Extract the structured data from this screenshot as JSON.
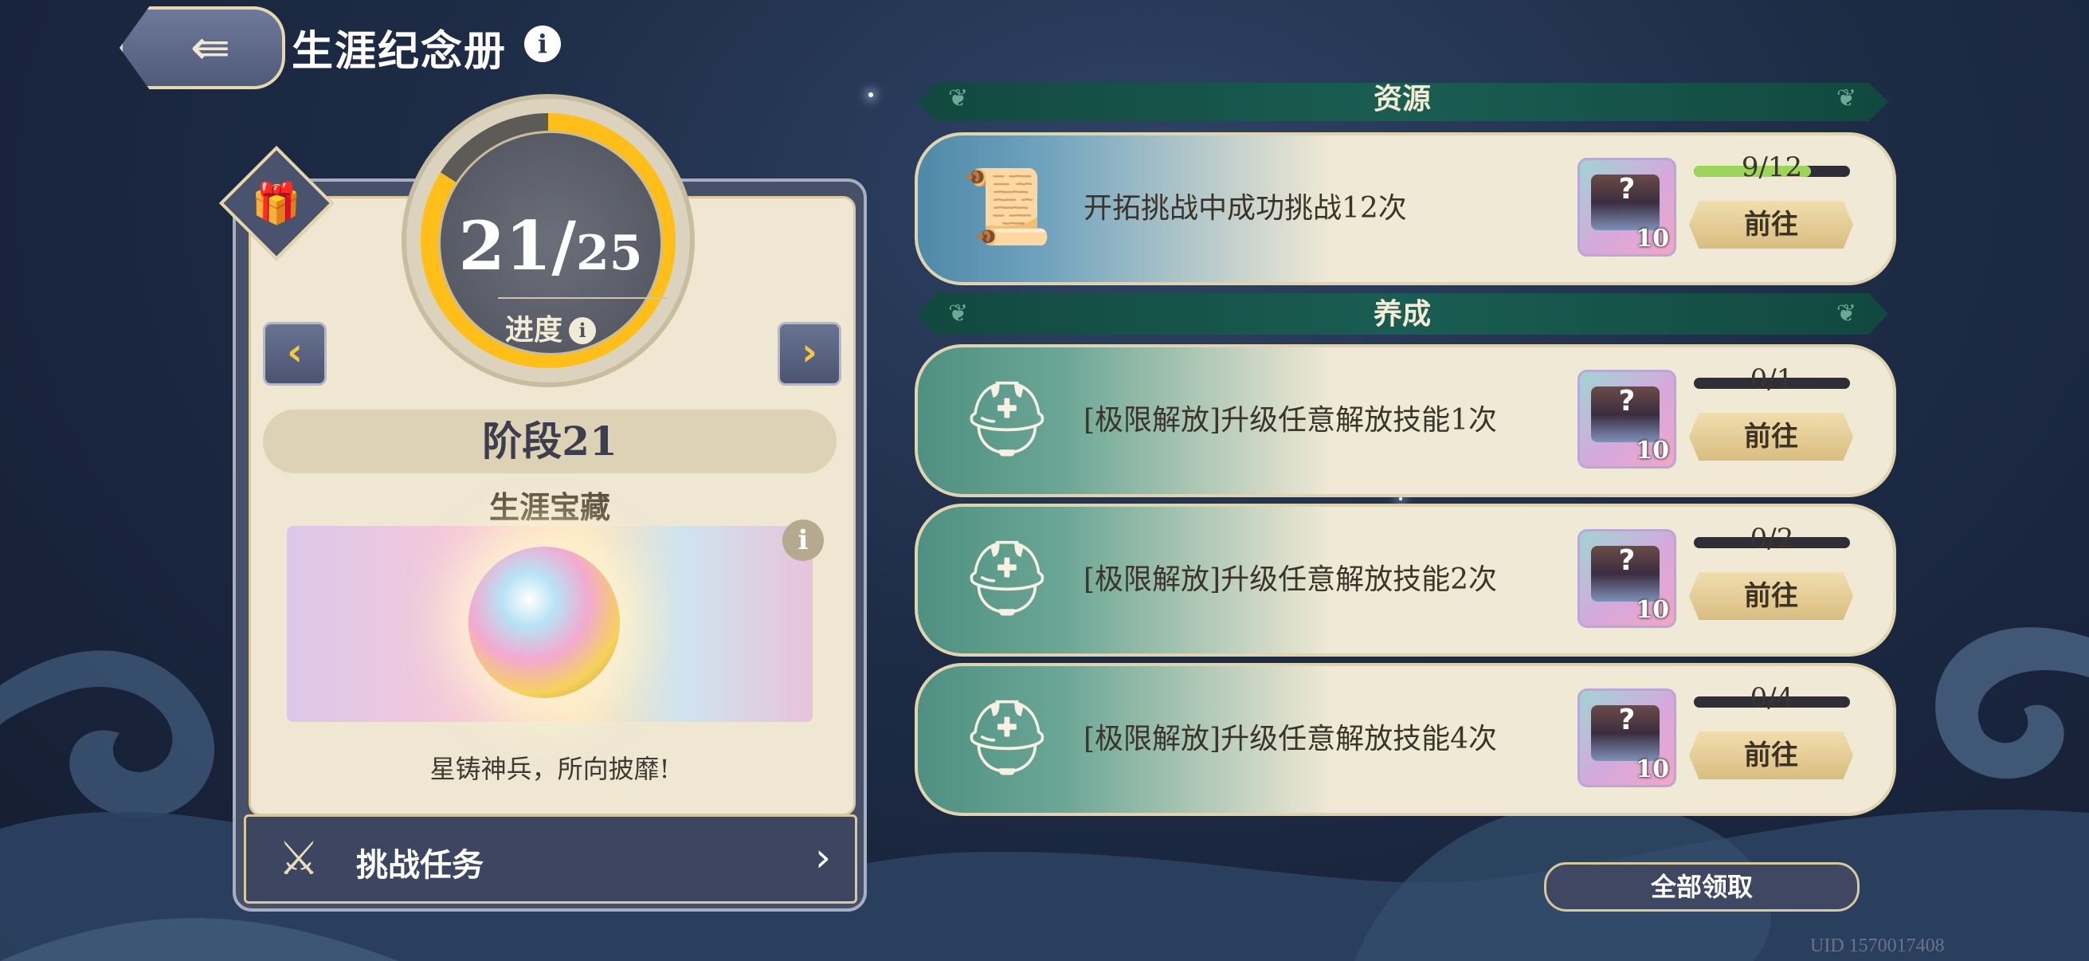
{
  "header": {
    "title": "生涯纪念册",
    "info_label": "i"
  },
  "progress": {
    "current": "21",
    "separator": "/",
    "max": "25",
    "label": "进度",
    "fraction": 0.84
  },
  "stage": {
    "title": "阶段21",
    "treasure_title": "生涯宝藏",
    "treasure_desc": "星铸神兵，所向披靡!",
    "info_label": "i"
  },
  "challenge": {
    "label": "挑战任务"
  },
  "sections": {
    "resource": "资源",
    "cultivate": "养成"
  },
  "tasks": [
    {
      "text": "开拓挑战中成功挑战12次",
      "progress_text": "9/12",
      "progress_fraction": 0.75,
      "reward_count": "10",
      "button": "前往",
      "icon": "scroll-icon",
      "band": "blue"
    },
    {
      "text": "[极限解放]升级任意解放技能1次",
      "progress_text": "0/1",
      "progress_fraction": 0,
      "reward_count": "10",
      "button": "前往",
      "icon": "knight-helmet-icon",
      "band": "green"
    },
    {
      "text": "[极限解放]升级任意解放技能2次",
      "progress_text": "0/2",
      "progress_fraction": 0,
      "reward_count": "10",
      "button": "前往",
      "icon": "knight-helmet-icon",
      "band": "green"
    },
    {
      "text": "[极限解放]升级任意解放技能4次",
      "progress_text": "0/4",
      "progress_fraction": 0,
      "reward_count": "10",
      "button": "前往",
      "icon": "knight-helmet-icon",
      "band": "green"
    }
  ],
  "claim_all": "全部领取",
  "uid": "UID 1570017408",
  "colors": {
    "ring_fill": "#ffbf18",
    "progress_fill": "#9bd65a",
    "accent_gold": "#d8c99a"
  }
}
